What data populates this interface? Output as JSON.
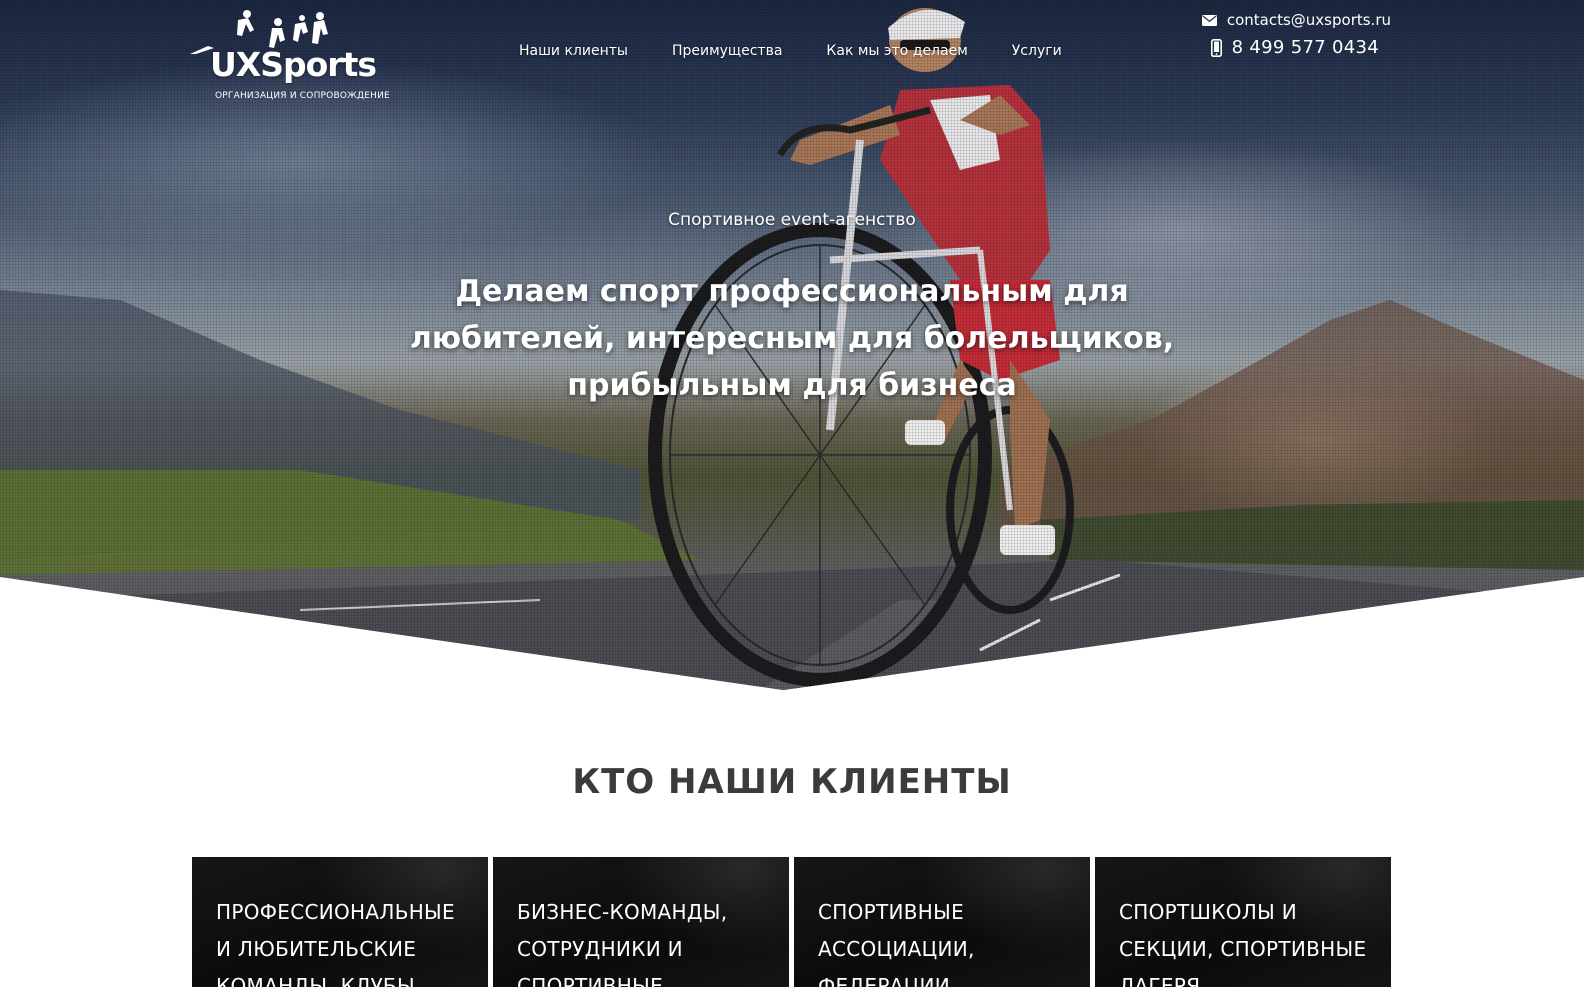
{
  "header": {
    "logo_text": "UXSports",
    "logo_tagline": "ОРГАНИЗАЦИЯ И СОПРОВОЖДЕНИЕ",
    "nav": [
      {
        "label": "Наши клиенты"
      },
      {
        "label": "Преимущества"
      },
      {
        "label": "Как мы это делаем"
      },
      {
        "label": "Услуги"
      }
    ],
    "email": "contacts@uxsports.ru",
    "phone": "8 499 577 0434"
  },
  "hero": {
    "subtitle": "Спортивное event-агенство",
    "title": "Делаем спорт профессиональным для любителей, интересным для болельщиков, прибыльным для бизнеса"
  },
  "clients": {
    "title": "КТО НАШИ КЛИЕНТЫ",
    "cards": [
      {
        "text": "Профессиональные и любительские команды, клубы"
      },
      {
        "text": "Бизнес-команды, сотрудники и спортивные"
      },
      {
        "text": "Спортивные ассоциации, федерации"
      },
      {
        "text": "Спортшколы и секции, спортивные лагеря"
      }
    ]
  },
  "icons": {
    "email": "envelope-icon",
    "phone": "mobile-phone-icon"
  },
  "colors": {
    "section_title": "#3b3b3b",
    "card_background": "#111111",
    "hero_text": "#ffffff"
  }
}
